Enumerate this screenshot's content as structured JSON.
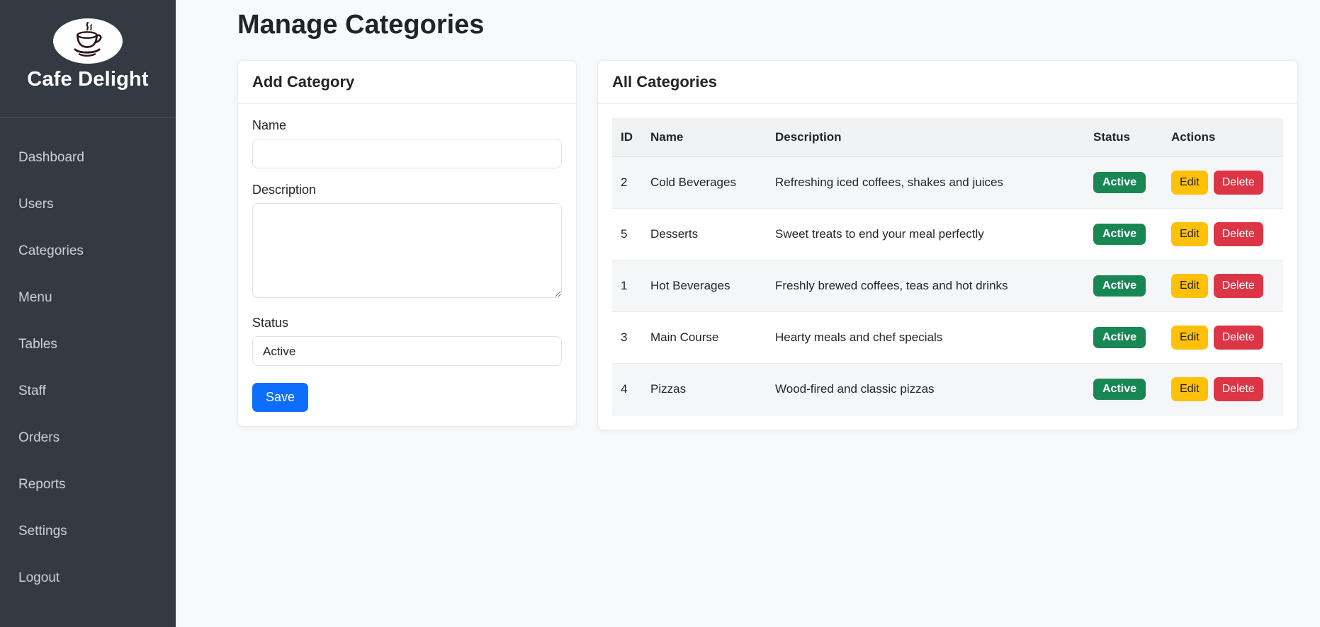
{
  "sidebar": {
    "brand": "Cafe Delight",
    "items": [
      {
        "label": "Dashboard"
      },
      {
        "label": "Users"
      },
      {
        "label": "Categories"
      },
      {
        "label": "Menu"
      },
      {
        "label": "Tables"
      },
      {
        "label": "Staff"
      },
      {
        "label": "Orders"
      },
      {
        "label": "Reports"
      },
      {
        "label": "Settings"
      },
      {
        "label": "Logout"
      }
    ]
  },
  "page": {
    "title": "Manage Categories"
  },
  "add_category": {
    "title": "Add Category",
    "name_label": "Name",
    "name_value": "",
    "description_label": "Description",
    "description_value": "",
    "status_label": "Status",
    "status_value": "Active",
    "save_label": "Save"
  },
  "all_categories": {
    "title": "All Categories",
    "table": {
      "headers": [
        "ID",
        "Name",
        "Description",
        "Status",
        "Actions"
      ],
      "rows": [
        {
          "id": "2",
          "name": "Cold Beverages",
          "description": "Refreshing iced coffees, shakes and juices",
          "status": "Active",
          "edit_label": "Edit",
          "delete_label": "Delete"
        },
        {
          "id": "5",
          "name": "Desserts",
          "description": "Sweet treats to end your meal perfectly",
          "status": "Active",
          "edit_label": "Edit",
          "delete_label": "Delete"
        },
        {
          "id": "1",
          "name": "Hot Beverages",
          "description": "Freshly brewed coffees, teas and hot drinks",
          "status": "Active",
          "edit_label": "Edit",
          "delete_label": "Delete"
        },
        {
          "id": "3",
          "name": "Main Course",
          "description": "Hearty meals and chef specials",
          "status": "Active",
          "edit_label": "Edit",
          "delete_label": "Delete"
        },
        {
          "id": "4",
          "name": "Pizzas",
          "description": "Wood-fired and classic pizzas",
          "status": "Active",
          "edit_label": "Edit",
          "delete_label": "Delete"
        }
      ]
    }
  },
  "colors": {
    "sidebar_bg": "#333a42",
    "primary": "#0d6efd",
    "success": "#198754",
    "warning": "#ffc107",
    "danger": "#dc3545"
  }
}
